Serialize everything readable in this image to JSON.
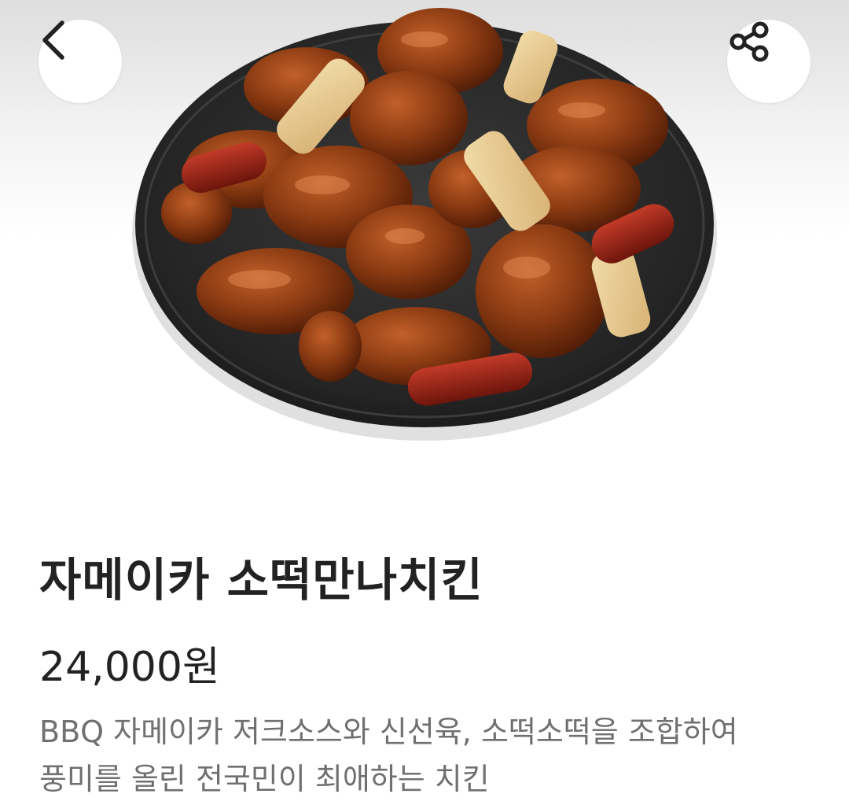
{
  "product": {
    "name": "자메이카 소떡만나치킨",
    "price": "24,000원",
    "description_lines": [
      "BBQ 자메이카 저크소스와 신선육, 소떡소떡을 조합하여",
      "풍미를 올린 전국민이 최애하는 치킨"
    ]
  },
  "icons": {
    "back": "chevron-left-icon",
    "share": "share-icon"
  },
  "colors": {
    "title": "#222222",
    "description": "#707070",
    "plate": "#2a2a2a",
    "chicken": "#8a3a12",
    "rice_cake": "#e8c98a",
    "sausage": "#9a2318"
  }
}
